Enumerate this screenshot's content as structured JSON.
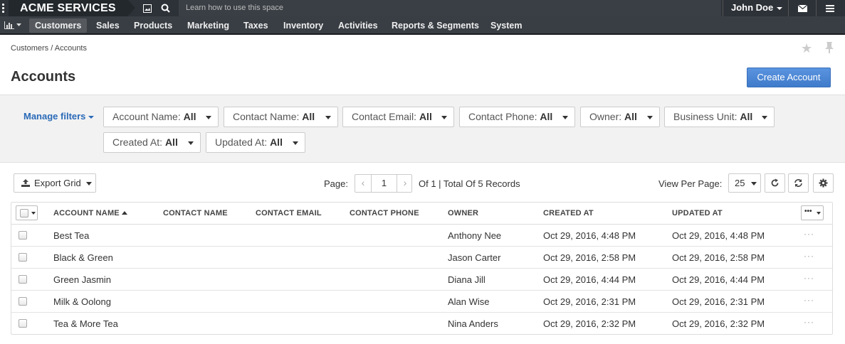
{
  "app": {
    "brand": "ACME SERVICES",
    "learn_text": "Learn how to use this space",
    "user_name": "John Doe"
  },
  "menu": {
    "items": [
      "Customers",
      "Sales",
      "Products",
      "Marketing",
      "Taxes",
      "Inventory",
      "Activities",
      "Reports & Segments",
      "System"
    ],
    "active": "Customers"
  },
  "breadcrumb": {
    "parts": "Customers / Accounts"
  },
  "page": {
    "title": "Accounts",
    "create_label": "Create Account"
  },
  "filters": {
    "manage_label": "Manage filters",
    "items": [
      {
        "label": "Account Name:",
        "value": "All"
      },
      {
        "label": "Contact Name:",
        "value": "All"
      },
      {
        "label": "Contact Email:",
        "value": "All"
      },
      {
        "label": "Contact Phone:",
        "value": "All"
      },
      {
        "label": "Owner:",
        "value": "All"
      },
      {
        "label": "Business Unit:",
        "value": "All"
      },
      {
        "label": "Created At:",
        "value": "All"
      },
      {
        "label": "Updated At:",
        "value": "All"
      }
    ]
  },
  "toolbar": {
    "export_label": "Export Grid",
    "page_label": "Page:",
    "page_value": "1",
    "of_text": "Of 1 | Total Of 5 Records",
    "view_per_page_label": "View Per Page:",
    "per_page": "25"
  },
  "grid": {
    "columns": [
      "ACCOUNT NAME",
      "CONTACT NAME",
      "CONTACT EMAIL",
      "CONTACT PHONE",
      "OWNER",
      "CREATED AT",
      "UPDATED AT"
    ],
    "menu_label": "•••",
    "rows": [
      {
        "name": "Best Tea",
        "owner": "Anthony Nee",
        "created": "Oct 29, 2016, 4:48 PM",
        "updated": "Oct 29, 2016, 4:48 PM"
      },
      {
        "name": "Black & Green",
        "owner": "Jason Carter",
        "created": "Oct 29, 2016, 2:58 PM",
        "updated": "Oct 29, 2016, 2:58 PM"
      },
      {
        "name": "Green Jasmin",
        "owner": "Diana Jill",
        "created": "Oct 29, 2016, 4:44 PM",
        "updated": "Oct 29, 2016, 4:44 PM"
      },
      {
        "name": "Milk & Oolong",
        "owner": "Alan Wise",
        "created": "Oct 29, 2016, 2:31 PM",
        "updated": "Oct 29, 2016, 2:31 PM"
      },
      {
        "name": "Tea & More Tea",
        "owner": "Nina Anders",
        "created": "Oct 29, 2016, 2:32 PM",
        "updated": "Oct 29, 2016, 2:32 PM"
      }
    ],
    "row_action_glyph": "···"
  },
  "colors": {
    "topbar": "#2d3238",
    "menubar": "#393e44",
    "accent": "#4a86d4",
    "link": "#2a6ab8"
  }
}
